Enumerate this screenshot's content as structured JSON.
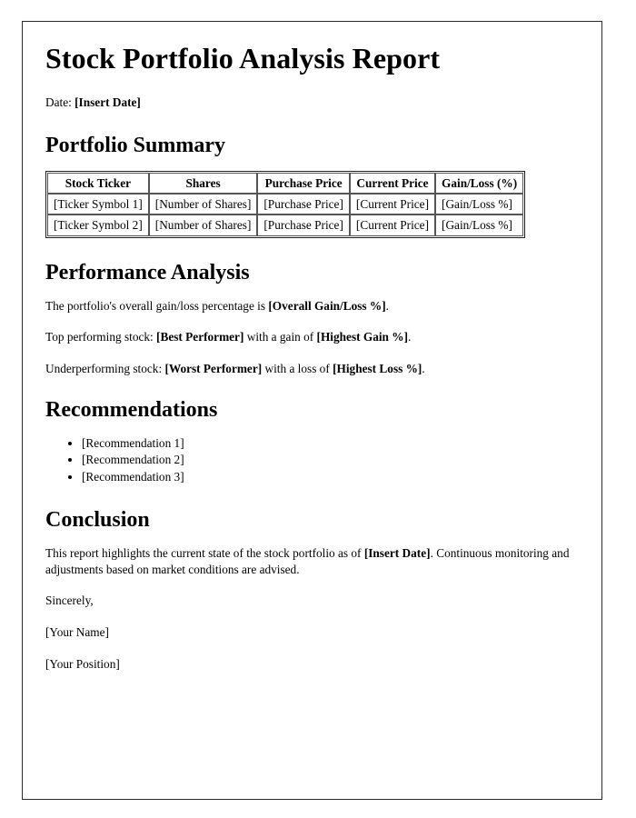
{
  "document": {
    "title": "Stock Portfolio Analysis Report",
    "date_label": "Date:",
    "date_value": "[Insert Date]"
  },
  "portfolio_summary": {
    "heading": "Portfolio Summary",
    "columns": [
      "Stock Ticker",
      "Shares",
      "Purchase Price",
      "Current Price",
      "Gain/Loss (%)"
    ],
    "rows": [
      [
        "[Ticker Symbol 1]",
        "[Number of Shares]",
        "[Purchase Price]",
        "[Current Price]",
        "[Gain/Loss %]"
      ],
      [
        "[Ticker Symbol 2]",
        "[Number of Shares]",
        "[Purchase Price]",
        "[Current Price]",
        "[Gain/Loss %]"
      ]
    ]
  },
  "performance_analysis": {
    "heading": "Performance Analysis",
    "overall": {
      "prefix": "The portfolio's overall gain/loss percentage is ",
      "value": "[Overall Gain/Loss %]",
      "suffix": "."
    },
    "top": {
      "prefix": "Top performing stock: ",
      "value": "[Best Performer]",
      "middle": " with a gain of ",
      "value2": "[Highest Gain %]",
      "suffix": "."
    },
    "under": {
      "prefix": "Underperforming stock: ",
      "value": "[Worst Performer]",
      "middle": " with a loss of ",
      "value2": "[Highest Loss %]",
      "suffix": "."
    }
  },
  "recommendations": {
    "heading": "Recommendations",
    "items": [
      "[Recommendation 1]",
      "[Recommendation 2]",
      "[Recommendation 3]"
    ]
  },
  "conclusion": {
    "heading": "Conclusion",
    "body_prefix": "This report highlights the current state of the stock portfolio as of ",
    "body_value": "[Insert Date]",
    "body_suffix": ". Continuous monitoring and adjustments based on market conditions are advised.",
    "signoff": "Sincerely,",
    "name": "[Your Name]",
    "position": "[Your Position]"
  }
}
